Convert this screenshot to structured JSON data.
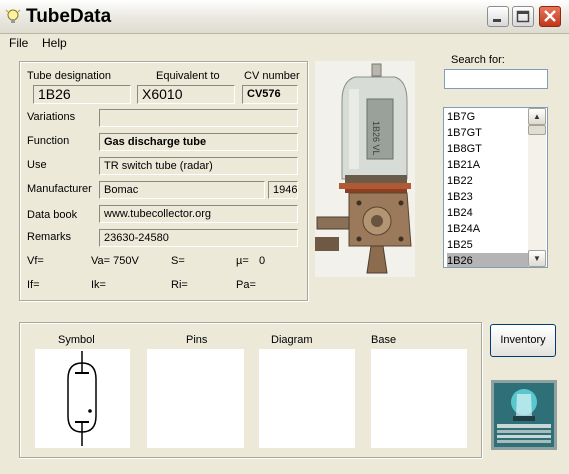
{
  "window": {
    "title": "TubeData"
  },
  "menu": {
    "file": "File",
    "help": "Help"
  },
  "tube": {
    "designation_label": "Tube designation",
    "designation": "1B26",
    "equivalent_label": "Equivalent to",
    "equivalent": "X6010",
    "cv_label": "CV number",
    "cv": "CV576",
    "variations_label": "Variations",
    "variations": "",
    "function_label": "Function",
    "function": "Gas discharge tube",
    "use_label": "Use",
    "use": "TR switch tube (radar)",
    "manufacturer_label": "Manufacturer",
    "manufacturer": "Bomac",
    "year": "1946",
    "databook_label": "Data book",
    "databook": "www.tubecollector.org",
    "remarks_label": "Remarks",
    "remarks": "23630-24580",
    "params": {
      "vf": "Vf=",
      "va": "Va= 750V",
      "s": "S=",
      "mu": "µ=",
      "mu_val": "0",
      "if": "If=",
      "ik": "Ik=",
      "ri": "Ri=",
      "pa": "Pa="
    }
  },
  "search": {
    "label": "Search for:",
    "value": ""
  },
  "list": {
    "items": [
      "1B7G",
      "1B7GT",
      "1B8GT",
      "1B21A",
      "1B22",
      "1B23",
      "1B24",
      "1B24A",
      "1B25",
      "1B26"
    ],
    "selected": "1B26"
  },
  "panels": {
    "symbol": "Symbol",
    "pins": "Pins",
    "diagram": "Diagram",
    "base": "Base"
  },
  "buttons": {
    "inventory": "Inventory"
  },
  "photo_labels": {
    "tube_text": "1B26 VL"
  },
  "icons": {
    "app": "lightbulb-icon",
    "minimize": "minimize-icon",
    "maximize": "maximize-icon",
    "close": "close-icon"
  },
  "colors": {
    "window_bg": "#ece9d8",
    "close_red": "#c2351a",
    "selection": "#b4b4b4"
  }
}
